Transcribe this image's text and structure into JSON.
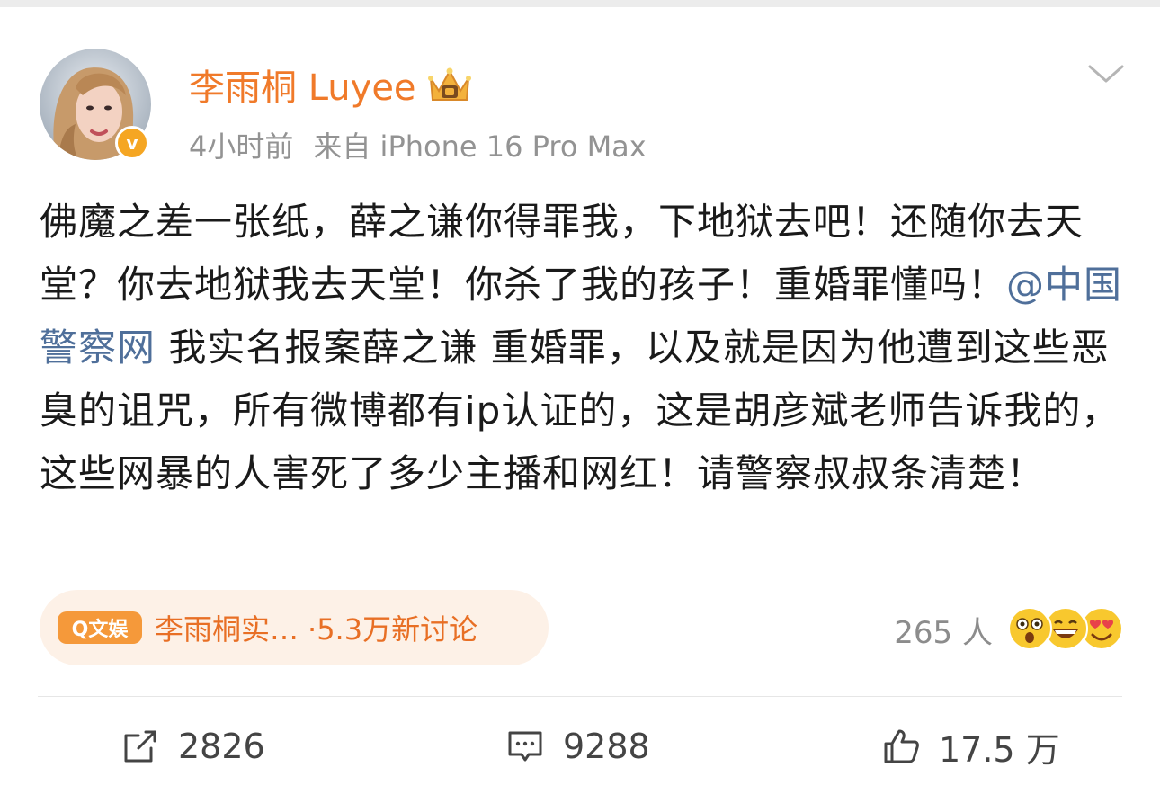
{
  "user": {
    "name": "李雨桐 Luyee",
    "verified_mark": "v",
    "time_ago": "4小时前",
    "source": "来自 iPhone 16 Pro Max"
  },
  "post": {
    "text_before_mention": "佛魔之差一张纸，薛之谦你得罪我，下地狱去吧！还随你去天堂？你去地狱我去天堂！你杀了我的孩子！重婚罪懂吗！",
    "mention": "@中国警察网",
    "text_after_mention": " 我实名报案薛之谦 重婚罪，以及就是因为他遭到这些恶臭的诅咒，所有微博都有ip认证的，这是胡彦斌老师告诉我的，这些网暴的人害死了多少主播和网红！请警察叔叔条清楚！"
  },
  "topic": {
    "badge": "Q文娱",
    "name": "李雨桐实…",
    "discussion": "·5.3万新讨论"
  },
  "reactions": {
    "count": "265 人",
    "emoji_icons": [
      "shocked-emoji-icon",
      "grin-emoji-icon",
      "heart-eyes-emoji-icon"
    ]
  },
  "actions": {
    "repost": "2826",
    "comment": "9288",
    "like": "17.5 万"
  },
  "colors": {
    "username": "#f07a2a",
    "mention": "#4f6f9a",
    "topic_bg": "#fdf1e7",
    "topic_text": "#e86f25",
    "verified": "#f5a623"
  }
}
